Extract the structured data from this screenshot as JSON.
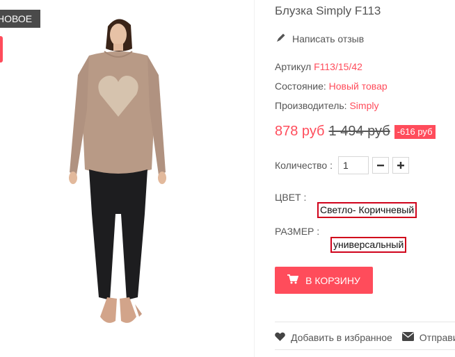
{
  "badges": {
    "new_label": "Новое"
  },
  "product": {
    "title": "Блузка Simply F113",
    "review_link": "Написать отзыв",
    "sku_label": "Артикул",
    "sku_value": "F113/15/42",
    "condition_label": "Состояние:",
    "condition_value": "Новый товар",
    "manufacturer_label": "Производитель:",
    "manufacturer_value": "Simply",
    "price": "878 руб",
    "old_price": "1 494 руб",
    "discount": "-616 руб",
    "quantity_label": "Количество :",
    "quantity_value": "1",
    "color_label": "ЦВЕТ :",
    "color_value": "Светло- Коричневый",
    "size_label": "РАЗМЕР :",
    "size_value": "универсальный",
    "add_to_cart": "В корзину",
    "wishlist_link": "Добавить в избранное",
    "send_link": "Отправить"
  },
  "colors": {
    "accent": "#ff4c5b",
    "highlight_border": "#d0021b"
  },
  "icons": {
    "review": "pencil-icon",
    "cart": "cart-icon",
    "wishlist": "heart-icon",
    "send": "envelope-icon",
    "minus": "minus-icon",
    "plus": "plus-icon"
  }
}
